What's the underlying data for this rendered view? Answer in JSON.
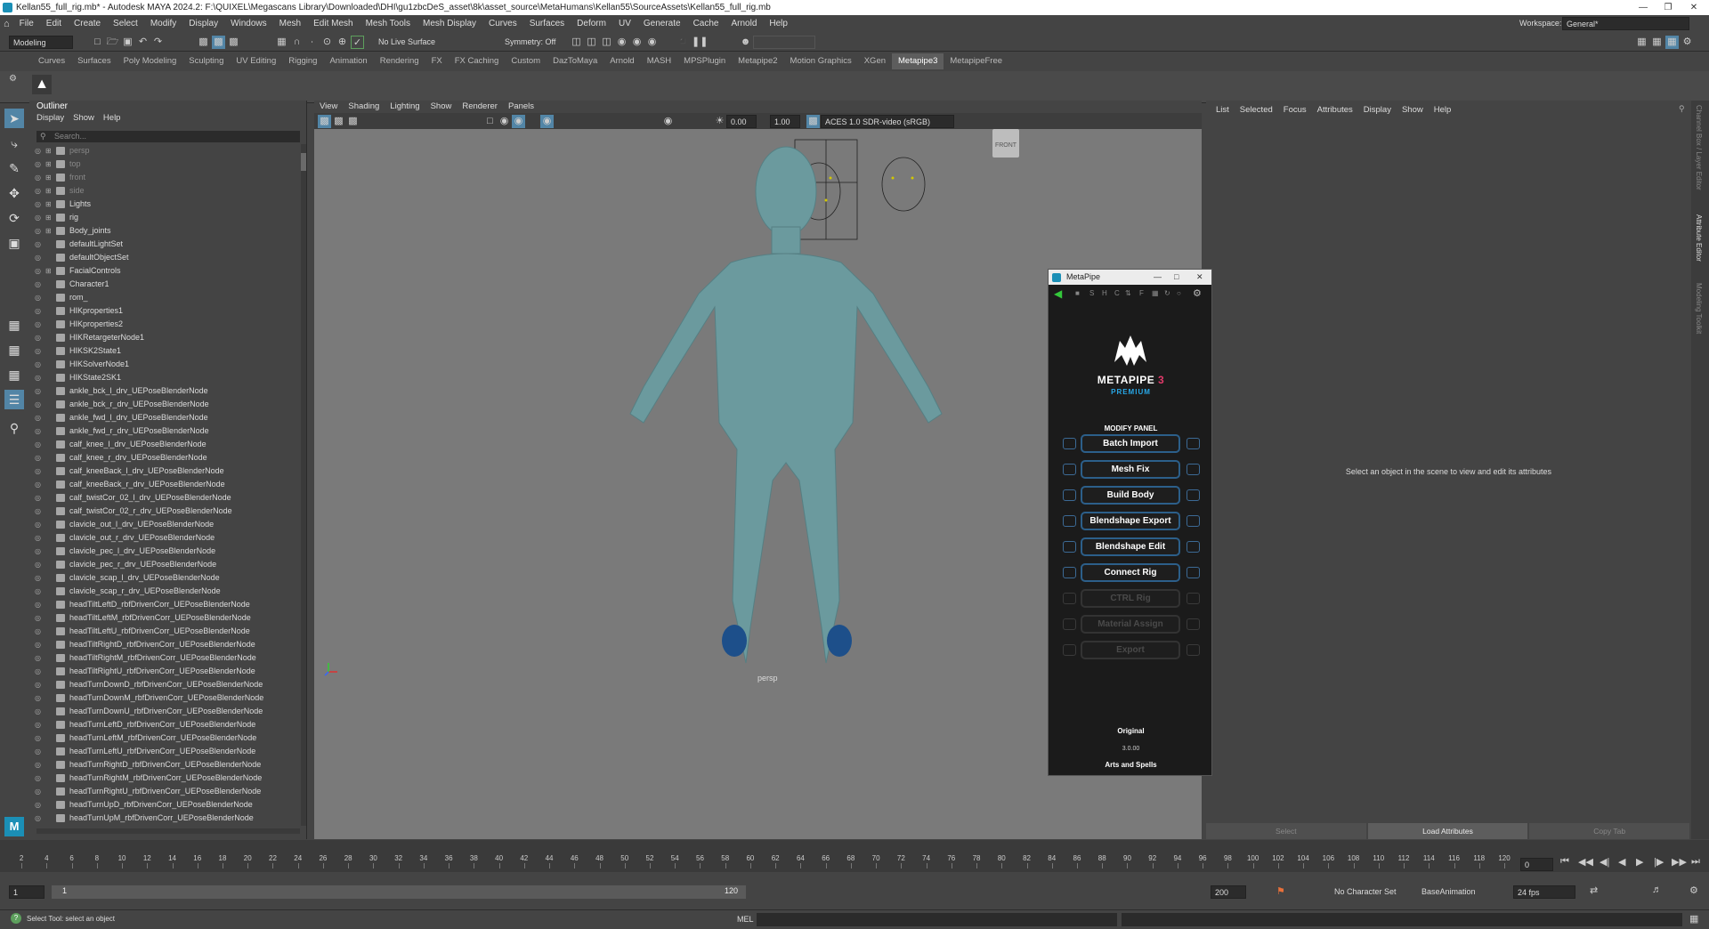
{
  "window": {
    "title": "Kellan55_full_rig.mb* - Autodesk MAYA 2024.2: F:\\QUIXEL\\Megascans Library\\Downloaded\\DHI\\gu1zbcDeS_asset\\8k\\asset_source\\MetaHumans\\Kellan55\\SourceAssets\\Kellan55_full_rig.mb"
  },
  "menubar": [
    "File",
    "Edit",
    "Create",
    "Select",
    "Modify",
    "Display",
    "Windows",
    "Mesh",
    "Edit Mesh",
    "Mesh Tools",
    "Mesh Display",
    "Curves",
    "Surfaces",
    "Deform",
    "UV",
    "Generate",
    "Cache",
    "Arnold",
    "Help"
  ],
  "workspace": {
    "label": "Workspace:",
    "value": "General*"
  },
  "statusline": {
    "mode": "Modeling",
    "live_surface": "No Live Surface",
    "symmetry": "Symmetry: Off"
  },
  "shelf_tabs": [
    "Curves",
    "Surfaces",
    "Poly Modeling",
    "Sculpting",
    "UV Editing",
    "Rigging",
    "Animation",
    "Rendering",
    "FX",
    "FX Caching",
    "Custom",
    "DazToMaya",
    "Arnold",
    "MASH",
    "MPSPlugin",
    "Metapipe2",
    "Motion Graphics",
    "XGen",
    "Metapipe3",
    "MetapipeFree"
  ],
  "active_shelf": "Metapipe3",
  "outliner": {
    "title": "Outliner",
    "menu": [
      "Display",
      "Show",
      "Help"
    ],
    "search_placeholder": "Search...",
    "items": [
      {
        "label": "persp",
        "dim": true,
        "exp": true
      },
      {
        "label": "top",
        "dim": true,
        "exp": true
      },
      {
        "label": "front",
        "dim": true,
        "exp": true
      },
      {
        "label": "side",
        "dim": true,
        "exp": true
      },
      {
        "label": "Lights",
        "exp": true
      },
      {
        "label": "rig",
        "exp": true
      },
      {
        "label": "Body_joints",
        "exp": true
      },
      {
        "label": "defaultLightSet"
      },
      {
        "label": "defaultObjectSet"
      },
      {
        "label": "FacialControls",
        "exp": true
      },
      {
        "label": "Character1"
      },
      {
        "label": "rom_"
      },
      {
        "label": "HIKproperties1"
      },
      {
        "label": "HIKproperties2"
      },
      {
        "label": "HIKRetargeterNode1"
      },
      {
        "label": "HIKSK2State1"
      },
      {
        "label": "HIKSolverNode1"
      },
      {
        "label": "HIKState2SK1"
      },
      {
        "label": "ankle_bck_l_drv_UEPoseBlenderNode"
      },
      {
        "label": "ankle_bck_r_drv_UEPoseBlenderNode"
      },
      {
        "label": "ankle_fwd_l_drv_UEPoseBlenderNode"
      },
      {
        "label": "ankle_fwd_r_drv_UEPoseBlenderNode"
      },
      {
        "label": "calf_knee_l_drv_UEPoseBlenderNode"
      },
      {
        "label": "calf_knee_r_drv_UEPoseBlenderNode"
      },
      {
        "label": "calf_kneeBack_l_drv_UEPoseBlenderNode"
      },
      {
        "label": "calf_kneeBack_r_drv_UEPoseBlenderNode"
      },
      {
        "label": "calf_twistCor_02_l_drv_UEPoseBlenderNode"
      },
      {
        "label": "calf_twistCor_02_r_drv_UEPoseBlenderNode"
      },
      {
        "label": "clavicle_out_l_drv_UEPoseBlenderNode"
      },
      {
        "label": "clavicle_out_r_drv_UEPoseBlenderNode"
      },
      {
        "label": "clavicle_pec_l_drv_UEPoseBlenderNode"
      },
      {
        "label": "clavicle_pec_r_drv_UEPoseBlenderNode"
      },
      {
        "label": "clavicle_scap_l_drv_UEPoseBlenderNode"
      },
      {
        "label": "clavicle_scap_r_drv_UEPoseBlenderNode"
      },
      {
        "label": "headTiltLeftD_rbfDrivenCorr_UEPoseBlenderNode"
      },
      {
        "label": "headTiltLeftM_rbfDrivenCorr_UEPoseBlenderNode"
      },
      {
        "label": "headTiltLeftU_rbfDrivenCorr_UEPoseBlenderNode"
      },
      {
        "label": "headTiltRightD_rbfDrivenCorr_UEPoseBlenderNode"
      },
      {
        "label": "headTiltRightM_rbfDrivenCorr_UEPoseBlenderNode"
      },
      {
        "label": "headTiltRightU_rbfDrivenCorr_UEPoseBlenderNode"
      },
      {
        "label": "headTurnDownD_rbfDrivenCorr_UEPoseBlenderNode"
      },
      {
        "label": "headTurnDownM_rbfDrivenCorr_UEPoseBlenderNode"
      },
      {
        "label": "headTurnDownU_rbfDrivenCorr_UEPoseBlenderNode"
      },
      {
        "label": "headTurnLeftD_rbfDrivenCorr_UEPoseBlenderNode"
      },
      {
        "label": "headTurnLeftM_rbfDrivenCorr_UEPoseBlenderNode"
      },
      {
        "label": "headTurnLeftU_rbfDrivenCorr_UEPoseBlenderNode"
      },
      {
        "label": "headTurnRightD_rbfDrivenCorr_UEPoseBlenderNode"
      },
      {
        "label": "headTurnRightM_rbfDrivenCorr_UEPoseBlenderNode"
      },
      {
        "label": "headTurnRightU_rbfDrivenCorr_UEPoseBlenderNode"
      },
      {
        "label": "headTurnUpD_rbfDrivenCorr_UEPoseBlenderNode"
      },
      {
        "label": "headTurnUpM_rbfDrivenCorr_UEPoseBlenderNode"
      }
    ]
  },
  "viewport": {
    "menu": [
      "View",
      "Shading",
      "Lighting",
      "Show",
      "Renderer",
      "Panels"
    ],
    "exposure": "0.00",
    "gamma": "1.00",
    "color_space": "ACES 1.0 SDR-video (sRGB)",
    "camera_label": "persp",
    "viewcube_label": "FRONT"
  },
  "attribute_editor": {
    "menu": [
      "List",
      "Selected",
      "Focus",
      "Attributes",
      "Display",
      "Show",
      "Help"
    ],
    "empty_message": "Select an object in the scene to view and edit its attributes",
    "bottom_buttons": [
      "Select",
      "Load Attributes",
      "Copy Tab"
    ]
  },
  "right_strip_tabs": [
    "Channel Box / Layer Editor",
    "Attribute Editor",
    "Modeling Toolkit"
  ],
  "metapipe": {
    "title": "MetaPipe",
    "toolbar_icons": [
      "back-arrow",
      "mode-icon",
      "S",
      "H",
      "C",
      "arrows",
      "F",
      "layout",
      "refresh",
      "circle"
    ],
    "brand": "METAPIPE",
    "brand_version": "3",
    "edition": "PREMIUM",
    "panel_title": "MODIFY PANEL",
    "buttons": [
      {
        "label": "Batch Import",
        "enabled": true
      },
      {
        "label": "Mesh Fix",
        "enabled": true
      },
      {
        "label": "Build Body",
        "enabled": true
      },
      {
        "label": "Blendshape Export",
        "enabled": true
      },
      {
        "label": "Blendshape Edit",
        "enabled": true
      },
      {
        "label": "Connect Rig",
        "enabled": true
      },
      {
        "label": "CTRL Rig",
        "enabled": false
      },
      {
        "label": "Material Assign",
        "enabled": false
      },
      {
        "label": "Export",
        "enabled": false
      }
    ],
    "footer_mode": "Original",
    "footer_version": "3.0.00",
    "footer_author": "Arts and Spells"
  },
  "timeslider": {
    "ticks": [
      2,
      4,
      6,
      8,
      10,
      12,
      14,
      16,
      18,
      20,
      22,
      24,
      26,
      28,
      30,
      32,
      34,
      36,
      38,
      40,
      42,
      44,
      46,
      48,
      50,
      52,
      54,
      56,
      58,
      60,
      62,
      64,
      66,
      68,
      70,
      72,
      74,
      76,
      78,
      80,
      82,
      84,
      86,
      88,
      90,
      92,
      94,
      96,
      98,
      100,
      102,
      104,
      106,
      108,
      110,
      112,
      114,
      116,
      118,
      120
    ],
    "current_frame": "0"
  },
  "range": {
    "start": "1",
    "inner_start": "1",
    "inner_end": "120",
    "end": "200",
    "character_set": "No Character Set",
    "anim_layer": "BaseAnimation",
    "fps": "24 fps"
  },
  "cmdline": {
    "help": "Select Tool: select an object",
    "mel_label": "MEL"
  }
}
